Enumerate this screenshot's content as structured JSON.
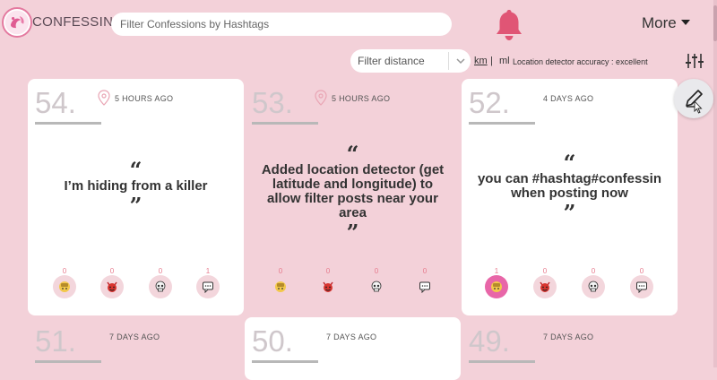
{
  "header": {
    "brand": "CONFESSIN",
    "search_placeholder": "Filter Confessions by Hashtags",
    "more_label": "More"
  },
  "filter": {
    "distance_placeholder": "Filter distance",
    "unit_km": "km",
    "unit_separator": "|",
    "unit_ml": "ml",
    "accuracy_text": "Location detector accuracy : excellent"
  },
  "colors": {
    "background": "#f3d1d9",
    "accent": "#e866a8",
    "bell": "#e05575"
  },
  "cards": [
    {
      "number": "54.",
      "time": "5 HOURS AGO",
      "text": "I’m hiding from a killer",
      "open_quote": "“",
      "close_quote": "”",
      "reactions": [
        {
          "icon": "hand-emoji-icon",
          "count": "0"
        },
        {
          "icon": "devil-emoji-icon",
          "count": "0"
        },
        {
          "icon": "skull-emoji-icon",
          "count": "0"
        },
        {
          "icon": "comment-icon",
          "count": "1"
        }
      ]
    },
    {
      "number": "53.",
      "time": "5 HOURS AGO",
      "text": "Added location detector (get latitude and longitude) to allow filter posts near your area",
      "open_quote": "“",
      "close_quote": "”",
      "reactions": [
        {
          "icon": "hand-emoji-icon",
          "count": "0"
        },
        {
          "icon": "devil-emoji-icon",
          "count": "0"
        },
        {
          "icon": "skull-emoji-icon",
          "count": "0"
        },
        {
          "icon": "comment-icon",
          "count": "0"
        }
      ]
    },
    {
      "number": "52.",
      "time": "4 DAYS AGO",
      "text": "you can #hashtag#confessin when posting now",
      "open_quote": "“",
      "close_quote": "”",
      "reactions": [
        {
          "icon": "hand-emoji-icon",
          "count": "1"
        },
        {
          "icon": "devil-emoji-icon",
          "count": "0"
        },
        {
          "icon": "skull-emoji-icon",
          "count": "0"
        },
        {
          "icon": "comment-icon",
          "count": "0"
        }
      ]
    },
    {
      "number": "51.",
      "time": "7 DAYS AGO"
    },
    {
      "number": "50.",
      "time": "7 DAYS AGO"
    },
    {
      "number": "49.",
      "time": "7 DAYS AGO"
    }
  ]
}
